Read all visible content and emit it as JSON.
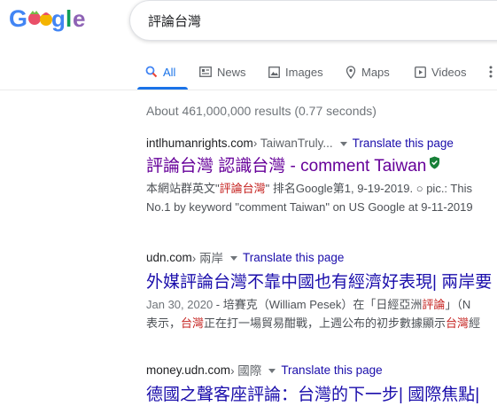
{
  "search": {
    "query": "評論台灣"
  },
  "logo": {
    "text": "Google"
  },
  "tabs": [
    {
      "label": "All",
      "icon": "search-icon"
    },
    {
      "label": "News",
      "icon": "news-icon"
    },
    {
      "label": "Images",
      "icon": "images-icon"
    },
    {
      "label": "Maps",
      "icon": "maps-pin-icon"
    },
    {
      "label": "Videos",
      "icon": "video-icon"
    },
    {
      "label": "",
      "icon": "more-vert-icon"
    }
  ],
  "stats": "About 461,000,000 results (0.77 seconds)",
  "results": [
    {
      "domain": "intlhumanrights.com",
      "path": " › TaiwanTruly...",
      "translate": "Translate this page",
      "title": "評論台灣 認識台灣 - comment Taiwan",
      "snippet1_a": "本網站群英文\"",
      "snippet1_hl": "評論台灣",
      "snippet1_b": "\" 排名Google第1, 9-19-2019. ○ pic.: This",
      "snippet2": "No.1 by keyword \"comment Taiwan\" on US Google at 9-11-2019"
    },
    {
      "domain": "udn.com",
      "path": " › 兩岸",
      "translate": "Translate this page",
      "title": "外媒評論台灣不靠中國也有經濟好表現| 兩岸要",
      "date": "Jan 30, 2020",
      "snippet1_a": " - 培賽克（William Pesek）在「日經亞洲",
      "snippet1_hl": "評論",
      "snippet1_b": "」（N",
      "snippet2_a": "表示，",
      "snippet2_hl": "台灣",
      "snippet2_b": "正在打一場貿易酣戰，上週公布的初步數據顯示",
      "snippet2_hl2": "台灣",
      "snippet2_c": "經"
    },
    {
      "domain": "money.udn.com",
      "path": " › 國際",
      "translate": "Translate this page",
      "title": "德國之聲客座評論：台灣的下一步| 國際焦點|"
    }
  ],
  "colors": {
    "accent": "#1a73e8",
    "link": "#1a0dab",
    "visited": "#660099",
    "highlight": "#c5221f"
  }
}
